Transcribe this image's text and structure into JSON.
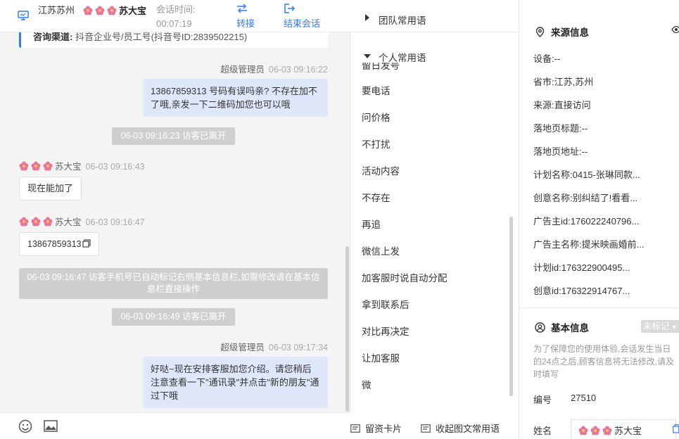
{
  "header": {
    "location": "江苏苏州",
    "visitor_name": "苏大宝",
    "session_time_label": "会话时间:",
    "session_time_value": "00:07:19",
    "transfer_label": "转接",
    "end_label": "结束会话"
  },
  "channel": {
    "label": "咨询渠道:",
    "value": "抖音企业号/员工号(抖音号ID:2839502215)"
  },
  "messages": [
    {
      "sender": "超级管理员",
      "time": "06-03 09:16:22",
      "text": "13867859313  号码有误吗亲?  不存在加不了哦,亲发一下二维码加您也可以哦"
    },
    {
      "system": "06-03 09:16:23 访客已离开"
    },
    {
      "sender": "苏大宝",
      "time": "06-03 09:16:43",
      "text": "现在能加了"
    },
    {
      "sender": "苏大宝",
      "time": "06-03 09:16:47",
      "text": "13867859313"
    },
    {
      "system": "06-03 09:16:47 访客手机号已自动标记右侧基本信息栏,如需修改请在基本信息栏直接操作"
    },
    {
      "system": "06-03 09:16:49 访客已离开"
    },
    {
      "sender": "超级管理员",
      "time": "06-03 09:17:34",
      "text": "好哒~现在安排客服加您介绍。请您稍后注意查看一下\"通讯录\"并点击\"新的朋友\"通过下哦"
    }
  ],
  "phrases": {
    "team_group": "团队常用语",
    "personal_group": "个人常用语",
    "cut_item": "留日发号",
    "items": [
      "要电话",
      "问价格",
      "不打扰",
      "活动内容",
      "不存在",
      "再追",
      "微信上发",
      "加客服时说自动分配",
      "拿到联系后",
      "对比再决定",
      "让加客服",
      "微"
    ],
    "footer_card": "留资卡片",
    "footer_collapse": "收起图文常用语"
  },
  "source_info": {
    "title": "来源信息",
    "fields": [
      "设备:--",
      "省市:江苏,苏州",
      "来源:直接访问",
      "落地页标题:--",
      "落地页地址:--",
      "计划名称:0415-张琳同款...",
      "创意名称:别纠结了!看看...",
      "广告主id:176022240796...",
      "广告主名称:提米映画婚前...",
      "计划id:176322900495...",
      "创意id:176322914767..."
    ]
  },
  "basic_info": {
    "title": "基本信息",
    "tag": "未标记",
    "note": "为了保障您的使用体验,会话发生当日的24点之后,顾客信息将无法修改,请及时填写",
    "id_label": "编号",
    "id_value": "27510",
    "name_label": "姓名",
    "name_value": "苏大宝"
  },
  "colors": {
    "accent": "#2f7bff",
    "agent_bubble": "#dfe8fb",
    "system_notice": "#cfcfcf"
  }
}
